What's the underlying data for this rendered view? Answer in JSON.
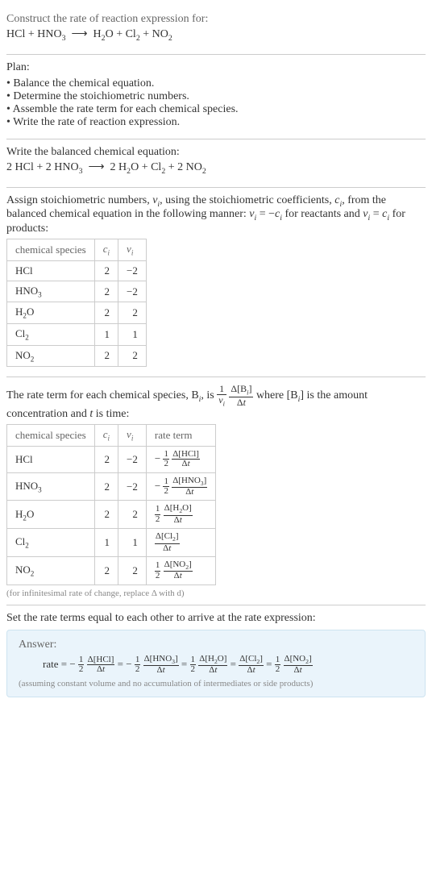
{
  "header": {
    "prompt": "Construct the rate of reaction expression for:",
    "equation_html": "HCl + HNO<span class='sub'>3</span> &nbsp;⟶&nbsp; H<span class='sub'>2</span>O + Cl<span class='sub'>2</span> + NO<span class='sub'>2</span>"
  },
  "plan": {
    "title": "Plan:",
    "items": [
      "Balance the chemical equation.",
      "Determine the stoichiometric numbers.",
      "Assemble the rate term for each chemical species.",
      "Write the rate of reaction expression."
    ]
  },
  "balanced": {
    "intro": "Write the balanced chemical equation:",
    "equation_html": "2 HCl + 2 HNO<span class='sub'>3</span> &nbsp;⟶&nbsp; 2 H<span class='sub'>2</span>O + Cl<span class='sub'>2</span> + 2 NO<span class='sub'>2</span>"
  },
  "stoich": {
    "intro_html": "Assign stoichiometric numbers, <i>ν<span class='sub'>i</span></i>, using the stoichiometric coefficients, <i>c<span class='sub'>i</span></i>, from the balanced chemical equation in the following manner: <i>ν<span class='sub'>i</span></i> = −<i>c<span class='sub'>i</span></i> for reactants and <i>ν<span class='sub'>i</span></i> = <i>c<span class='sub'>i</span></i> for products:",
    "headers": [
      "chemical species",
      "c_i",
      "ν_i"
    ],
    "rows": [
      {
        "species_html": "HCl",
        "c": "2",
        "nu": "−2"
      },
      {
        "species_html": "HNO<span class='sub'>3</span>",
        "c": "2",
        "nu": "−2"
      },
      {
        "species_html": "H<span class='sub'>2</span>O",
        "c": "2",
        "nu": "2"
      },
      {
        "species_html": "Cl<span class='sub'>2</span>",
        "c": "1",
        "nu": "1"
      },
      {
        "species_html": "NO<span class='sub'>2</span>",
        "c": "2",
        "nu": "2"
      }
    ]
  },
  "rate_terms": {
    "intro_html": "The rate term for each chemical species, B<span class='sub'><i>i</i></span>, is <span class='frac'><span class='top'>1</span><span class='bot'><i>ν<span class=\"sub\">i</span></i></span></span> <span class='frac'><span class='top'>Δ[B<span class=\"sub\"><i>i</i></span>]</span><span class='bot'>Δ<i>t</i></span></span> where [B<span class='sub'><i>i</i></span>] is the amount concentration and <i>t</i> is time:",
    "headers": [
      "chemical species",
      "c_i",
      "ν_i",
      "rate term"
    ],
    "rows": [
      {
        "species_html": "HCl",
        "c": "2",
        "nu": "−2",
        "rate_html": "− <span class='inline-frac'><span class='t'>1</span><span class='b'>2</span></span> <span class='inline-frac'><span class='t'>Δ[HCl]</span><span class='b'>Δ<i>t</i></span></span>"
      },
      {
        "species_html": "HNO<span class='sub'>3</span>",
        "c": "2",
        "nu": "−2",
        "rate_html": "− <span class='inline-frac'><span class='t'>1</span><span class='b'>2</span></span> <span class='inline-frac'><span class='t'>Δ[HNO<span class=\"sub\">3</span>]</span><span class='b'>Δ<i>t</i></span></span>"
      },
      {
        "species_html": "H<span class='sub'>2</span>O",
        "c": "2",
        "nu": "2",
        "rate_html": "<span class='inline-frac'><span class='t'>1</span><span class='b'>2</span></span> <span class='inline-frac'><span class='t'>Δ[H<span class=\"sub\">2</span>O]</span><span class='b'>Δ<i>t</i></span></span>"
      },
      {
        "species_html": "Cl<span class='sub'>2</span>",
        "c": "1",
        "nu": "1",
        "rate_html": "<span class='inline-frac'><span class='t'>Δ[Cl<span class=\"sub\">2</span>]</span><span class='b'>Δ<i>t</i></span></span>"
      },
      {
        "species_html": "NO<span class='sub'>2</span>",
        "c": "2",
        "nu": "2",
        "rate_html": "<span class='inline-frac'><span class='t'>1</span><span class='b'>2</span></span> <span class='inline-frac'><span class='t'>Δ[NO<span class=\"sub\">2</span>]</span><span class='b'>Δ<i>t</i></span></span>"
      }
    ],
    "footnote": "(for infinitesimal rate of change, replace Δ with d)"
  },
  "final": {
    "intro": "Set the rate terms equal to each other to arrive at the rate expression:",
    "answer_label": "Answer:",
    "rate_html": "rate = − <span class='inline-frac'><span class='t'>1</span><span class='b'>2</span></span> <span class='inline-frac'><span class='t'>Δ[HCl]</span><span class='b'>Δ<i>t</i></span></span> = − <span class='inline-frac'><span class='t'>1</span><span class='b'>2</span></span> <span class='inline-frac'><span class='t'>Δ[HNO<span class=\"sub\">3</span>]</span><span class='b'>Δ<i>t</i></span></span> = <span class='inline-frac'><span class='t'>1</span><span class='b'>2</span></span> <span class='inline-frac'><span class='t'>Δ[H<span class=\"sub\">2</span>O]</span><span class='b'>Δ<i>t</i></span></span> = <span class='inline-frac'><span class='t'>Δ[Cl<span class=\"sub\">2</span>]</span><span class='b'>Δ<i>t</i></span></span> = <span class='inline-frac'><span class='t'>1</span><span class='b'>2</span></span> <span class='inline-frac'><span class='t'>Δ[NO<span class=\"sub\">2</span>]</span><span class='b'>Δ<i>t</i></span></span>",
    "note": "(assuming constant volume and no accumulation of intermediates or side products)"
  },
  "chart_data": {
    "type": "table",
    "tables": [
      {
        "title": "Stoichiometric numbers",
        "columns": [
          "chemical species",
          "c_i",
          "ν_i"
        ],
        "rows": [
          [
            "HCl",
            2,
            -2
          ],
          [
            "HNO3",
            2,
            -2
          ],
          [
            "H2O",
            2,
            2
          ],
          [
            "Cl2",
            1,
            1
          ],
          [
            "NO2",
            2,
            2
          ]
        ]
      },
      {
        "title": "Rate terms",
        "columns": [
          "chemical species",
          "c_i",
          "ν_i",
          "rate term"
        ],
        "rows": [
          [
            "HCl",
            2,
            -2,
            "-(1/2) Δ[HCl]/Δt"
          ],
          [
            "HNO3",
            2,
            -2,
            "-(1/2) Δ[HNO3]/Δt"
          ],
          [
            "H2O",
            2,
            2,
            "(1/2) Δ[H2O]/Δt"
          ],
          [
            "Cl2",
            1,
            1,
            "Δ[Cl2]/Δt"
          ],
          [
            "NO2",
            2,
            2,
            "(1/2) Δ[NO2]/Δt"
          ]
        ]
      }
    ]
  }
}
